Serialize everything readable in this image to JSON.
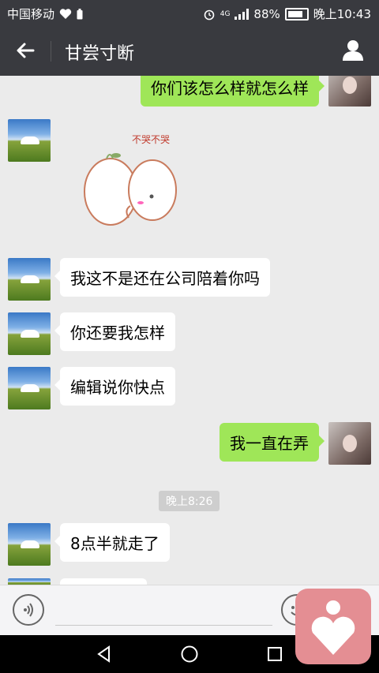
{
  "status_bar": {
    "carrier": "中国移动",
    "network": "4G",
    "battery": "88%",
    "time": "晚上10:43"
  },
  "header": {
    "title": "甘尝寸断"
  },
  "messages": [
    {
      "side": "out",
      "text": "你们该怎么样就怎么样"
    },
    {
      "side": "in",
      "type": "sticker",
      "sticker_text": "不哭不哭"
    },
    {
      "side": "in",
      "text": "我这不是还在公司陪着你吗"
    },
    {
      "side": "in",
      "text": "你还要我怎样"
    },
    {
      "side": "in",
      "text": "编辑说你快点"
    },
    {
      "side": "out",
      "text": "我一直在弄"
    },
    {
      "type": "timestamp",
      "text": "晚上8:26"
    },
    {
      "side": "in",
      "text": "8点半就走了"
    }
  ],
  "colors": {
    "bar": "#393a3f",
    "chat_bg": "#ebebeb",
    "bubble_out": "#9fe658",
    "bubble_in": "#ffffff",
    "overlay": "#e48e93"
  },
  "icons": {
    "back": "arrow-left-icon",
    "contact": "person-icon",
    "voice": "voice-icon",
    "emoji": "emoji-icon",
    "nav_back": "triangle-back-icon",
    "nav_home": "circle-home-icon",
    "nav_recent": "square-recent-icon",
    "overlay": "heart-app-icon"
  }
}
